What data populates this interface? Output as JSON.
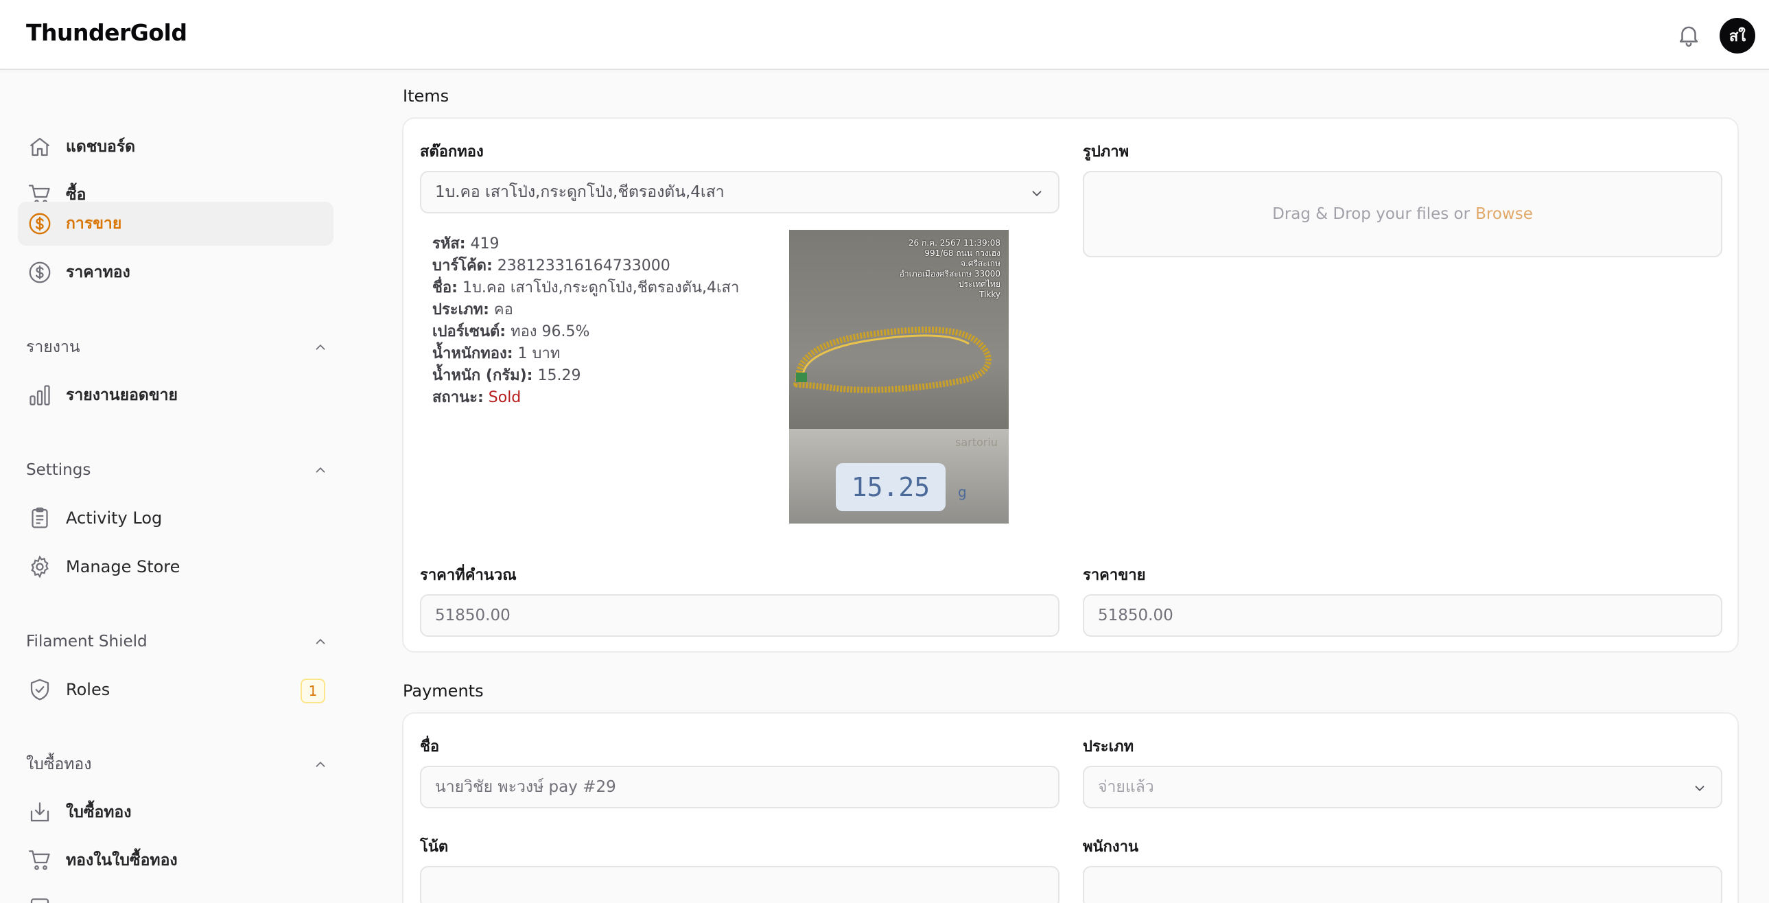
{
  "app": {
    "brand": "ThunderGold",
    "avatar_initials": "สใ"
  },
  "sidebar": {
    "main_items": [
      {
        "label": "แดชบอร์ด",
        "icon": "home-icon"
      },
      {
        "label": "ซื้อ",
        "icon": "cart-icon"
      },
      {
        "label": "การขาย",
        "icon": "dollar-icon",
        "active": true
      },
      {
        "label": "ราคาทอง",
        "icon": "dollar-icon"
      }
    ],
    "groups": [
      {
        "label": "รายงาน",
        "items": [
          {
            "label": "รายงานยอดขาย",
            "icon": "bar-chart-icon"
          }
        ]
      },
      {
        "label": "Settings",
        "items": [
          {
            "label": "Activity Log",
            "icon": "clipboard-icon"
          },
          {
            "label": "Manage Store",
            "icon": "gear-icon"
          }
        ]
      },
      {
        "label": "Filament Shield",
        "items": [
          {
            "label": "Roles",
            "icon": "shield-icon",
            "badge": "1"
          }
        ]
      },
      {
        "label": "ใบซื้อทอง",
        "items": [
          {
            "label": "ใบซื้อทอง",
            "icon": "download-tray-icon"
          },
          {
            "label": "ทองในใบซื้อทอง",
            "icon": "cart-icon"
          }
        ]
      }
    ]
  },
  "items_section": {
    "title": "Items",
    "stock_label": "สต๊อกทอง",
    "stock_value": "1บ.คอ เสาโป่ง,กระดูกโป่ง,ชีตรองตัน,4เสา",
    "image_label": "รูปภาพ",
    "dropzone_text": "Drag & Drop your files or",
    "dropzone_link": "Browse",
    "details": {
      "code_label": "รหัส:",
      "code": "419",
      "barcode_label": "บาร์โค้ด:",
      "barcode": "238123316164733000",
      "name_label": "ชื่อ:",
      "name": "1บ.คอ เสาโป่ง,กระดูกโป่ง,ชีตรองตัน,4เสา",
      "type_label": "ประเภท:",
      "type": "คอ",
      "percent_label": "เปอร์เซนต์:",
      "percent": "ทอง 96.5%",
      "gold_weight_label": "น้ำหนักทอง:",
      "gold_weight": "1 บาท",
      "gram_weight_label": "น้ำหนัก (กรัม):",
      "gram_weight": "15.29",
      "status_label": "สถานะ:",
      "status": "Sold"
    },
    "photo": {
      "stamp_lines": [
        "26 ก.ค. 2567 11:39:08",
        "991/68 ถนน กวงเฮง",
        "จ.ศรีสะเกษ",
        "อำเภอเมืองศรีสะเกษ 33000",
        "ประเทศไทย",
        "Tikky"
      ],
      "scale_reading": "15.25",
      "scale_unit": "g",
      "scale_brand": "sartoriu"
    },
    "calc_price_label": "ราคาที่คำนวณ",
    "calc_price": "51850.00",
    "sell_price_label": "ราคาขาย",
    "sell_price": "51850.00"
  },
  "payments_section": {
    "title": "Payments",
    "name_label": "ชื่อ",
    "name_value": "นายวิชัย พะวงษ์ pay #29",
    "type_label": "ประเภท",
    "type_value": "จ่ายแล้ว",
    "note_label": "โน้ต",
    "staff_label": "พนักงาน"
  },
  "colors": {
    "accent": "#d97706",
    "sold": "#b91c1c",
    "browse": "#e0a96a"
  }
}
